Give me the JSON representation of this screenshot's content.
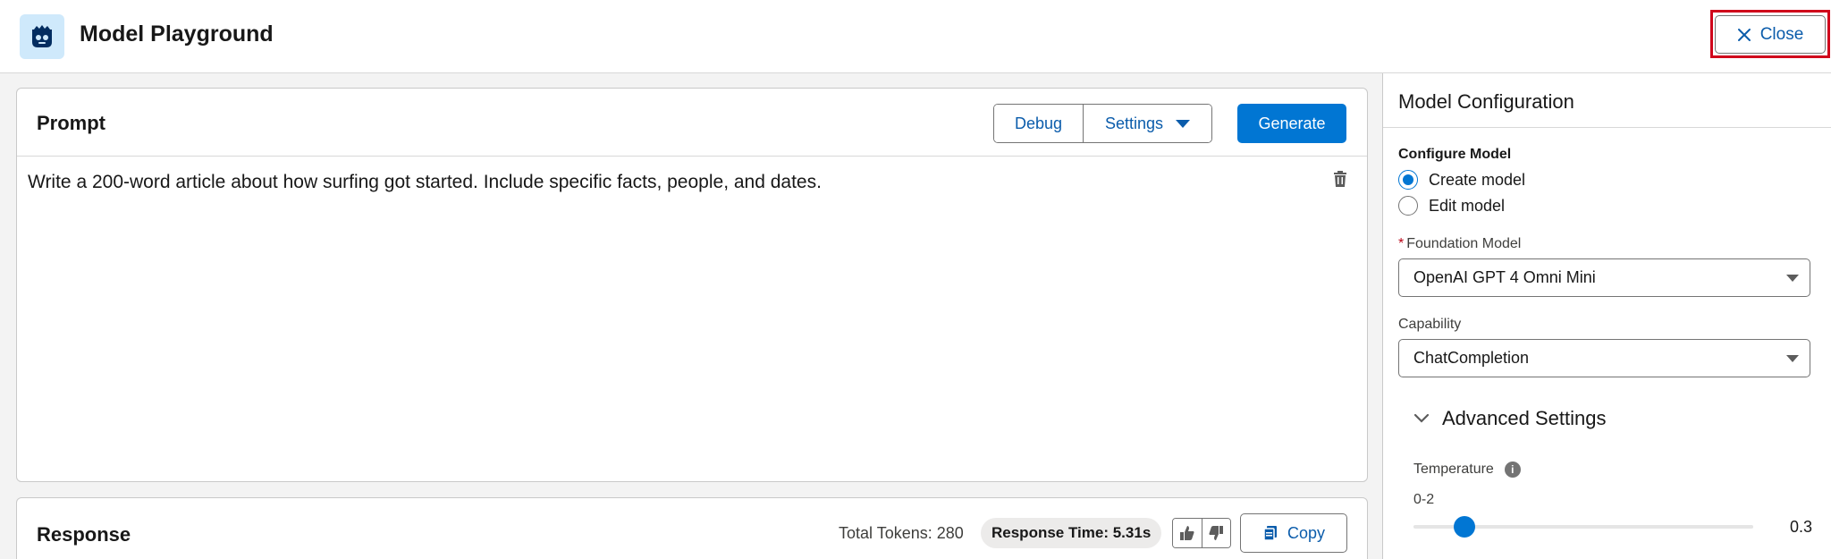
{
  "header": {
    "title": "Model Playground",
    "close_label": "Close"
  },
  "prompt": {
    "title": "Prompt",
    "debug_label": "Debug",
    "settings_label": "Settings",
    "generate_label": "Generate",
    "text": "Write a 200-word article about how surfing got started. Include specific facts, people, and dates."
  },
  "response": {
    "title": "Response",
    "total_tokens": "Total Tokens: 280",
    "response_time": "Response Time: 5.31s",
    "copy_label": "Copy"
  },
  "config": {
    "title": "Model Configuration",
    "configure_label": "Configure Model",
    "options": [
      {
        "label": "Create model",
        "selected": true
      },
      {
        "label": "Edit model",
        "selected": false
      }
    ],
    "foundation_label": "Foundation Model",
    "foundation_value": "OpenAI GPT 4 Omni Mini",
    "capability_label": "Capability",
    "capability_value": "ChatCompletion",
    "advanced_label": "Advanced Settings",
    "temperature_label": "Temperature",
    "temperature_range": "0-2",
    "temperature_value": "0.3"
  },
  "colors": {
    "brand": "#0176d3",
    "link": "#0b5cab",
    "highlight": "#d0021b"
  }
}
